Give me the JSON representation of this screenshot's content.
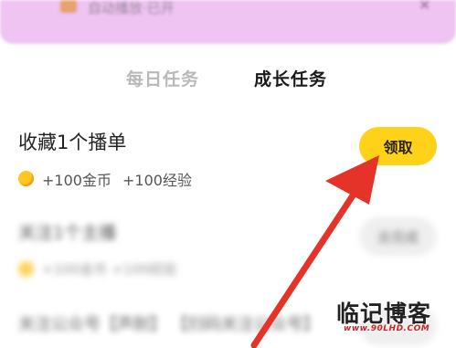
{
  "banner": {
    "text": "自动播放·已开",
    "close": "✕"
  },
  "tabs": [
    {
      "label": "每日任务",
      "active": false
    },
    {
      "label": "成长任务",
      "active": true
    }
  ],
  "task": {
    "title": "收藏1个播单",
    "reward_coins": "+100金币",
    "reward_exp": "+100经验",
    "claim_label": "领取"
  },
  "blurred_tasks": [
    {
      "title": "关注1个主播",
      "button": "去完成",
      "reward": "+100金币 +100经验"
    },
    {
      "title": "关注公众号【声耐】 【扫码关注公众号】"
    }
  ],
  "watermark": {
    "main": "临记博客",
    "url": "www.90LHD.COM"
  },
  "colors": {
    "banner": "#efc3f2",
    "claim_button": "#ffd21a",
    "coin": "#ffc626",
    "arrow": "#e5332a",
    "tab_active": "#1a1a1a",
    "tab_inactive": "#b9b9b9"
  }
}
